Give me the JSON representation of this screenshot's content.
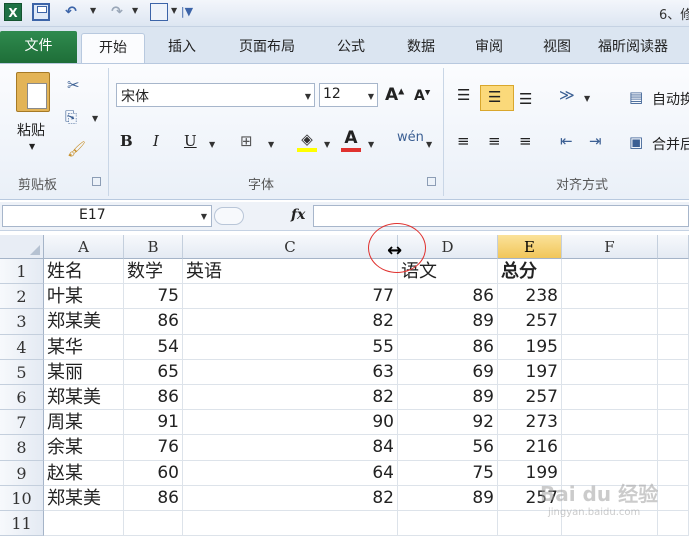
{
  "window": {
    "title": "6、修"
  },
  "ribbon_tabs": [
    "文件",
    "开始",
    "插入",
    "页面布局",
    "公式",
    "数据",
    "审阅",
    "视图",
    "福昕阅读器"
  ],
  "clipboard": {
    "paste_label": "粘贴",
    "group_label": "剪贴板"
  },
  "font": {
    "name": "宋体",
    "size": "12",
    "group_label": "字体",
    "bold": "B",
    "italic": "I",
    "underline": "U"
  },
  "alignment": {
    "group_label": "对齐方式",
    "wrap_label": "自动换",
    "merge_label": "合并后"
  },
  "formula_bar": {
    "name_box": "E17",
    "fx": "fx",
    "content": ""
  },
  "columns": [
    "A",
    "B",
    "C",
    "D",
    "E",
    "F"
  ],
  "rows": [
    "1",
    "2",
    "3",
    "4",
    "5",
    "6",
    "7",
    "8",
    "9",
    "10",
    "11"
  ],
  "headers": {
    "name": "姓名",
    "math": "数学",
    "english": "英语",
    "chinese": "语文",
    "total": "总分"
  },
  "records": [
    {
      "name": "叶某",
      "math": "75",
      "english": "77",
      "chinese": "86",
      "total": "238"
    },
    {
      "name": "郑某美",
      "math": "86",
      "english": "82",
      "chinese": "89",
      "total": "257"
    },
    {
      "name": "某华",
      "math": "54",
      "english": "55",
      "chinese": "86",
      "total": "195"
    },
    {
      "name": "某丽",
      "math": "65",
      "english": "63",
      "chinese": "69",
      "total": "197"
    },
    {
      "name": "郑某美",
      "math": "86",
      "english": "82",
      "chinese": "89",
      "total": "257"
    },
    {
      "name": "周某",
      "math": "91",
      "english": "90",
      "chinese": "92",
      "total": "273"
    },
    {
      "name": "余某",
      "math": "76",
      "english": "84",
      "chinese": "56",
      "total": "216"
    },
    {
      "name": "赵某",
      "math": "60",
      "english": "64",
      "chinese": "75",
      "total": "199"
    },
    {
      "name": "郑某美",
      "math": "86",
      "english": "82",
      "chinese": "89",
      "total": "257"
    }
  ],
  "watermark": {
    "text": "Bai du 经验",
    "url": "jingyan.baidu.com"
  },
  "colors": {
    "file_tab": "#2a7d44",
    "selected_col": "#f5cf6a",
    "highlight_circle": "#e0322f"
  }
}
